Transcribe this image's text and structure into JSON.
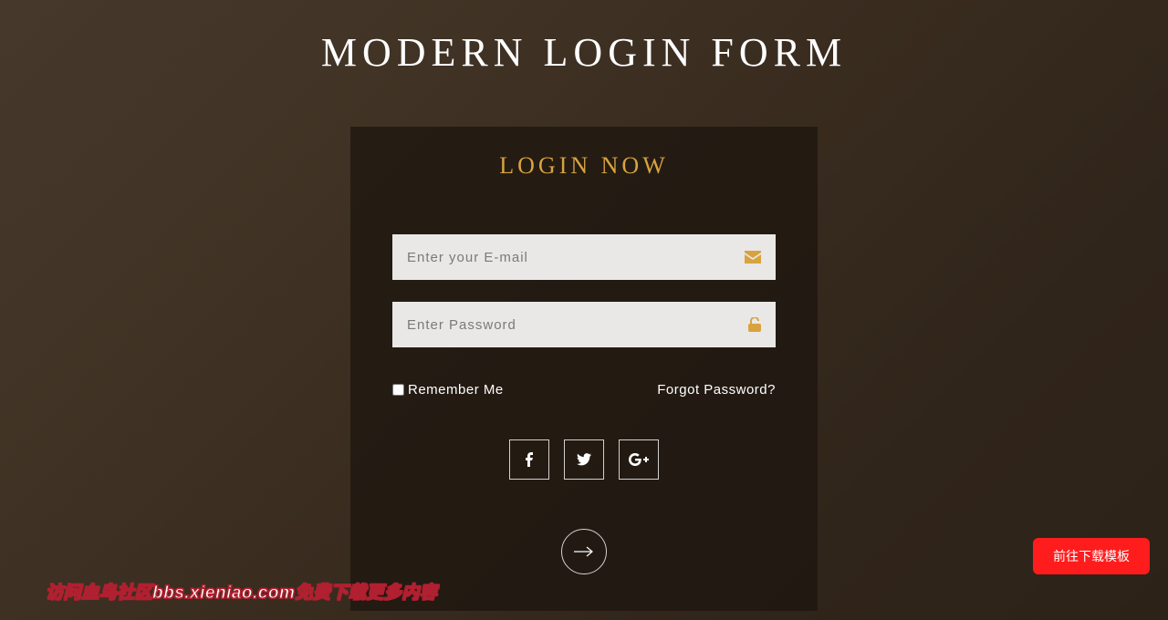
{
  "page": {
    "title": "MODERN LOGIN FORM"
  },
  "card": {
    "title": "LOGIN NOW"
  },
  "fields": {
    "email": {
      "placeholder": "Enter your E-mail",
      "value": ""
    },
    "password": {
      "placeholder": "Enter Password",
      "value": ""
    }
  },
  "options": {
    "remember_label": "Remember Me",
    "forgot_label": "Forgot Password?"
  },
  "social": {
    "facebook": "facebook",
    "twitter": "twitter",
    "google": "google-plus"
  },
  "watermark": "访问血鸟社区bbs.xieniao.com免费下载更多内容",
  "download_button": "前往下载模板",
  "colors": {
    "accent": "#d8a33f",
    "danger": "#ff1c1c"
  }
}
